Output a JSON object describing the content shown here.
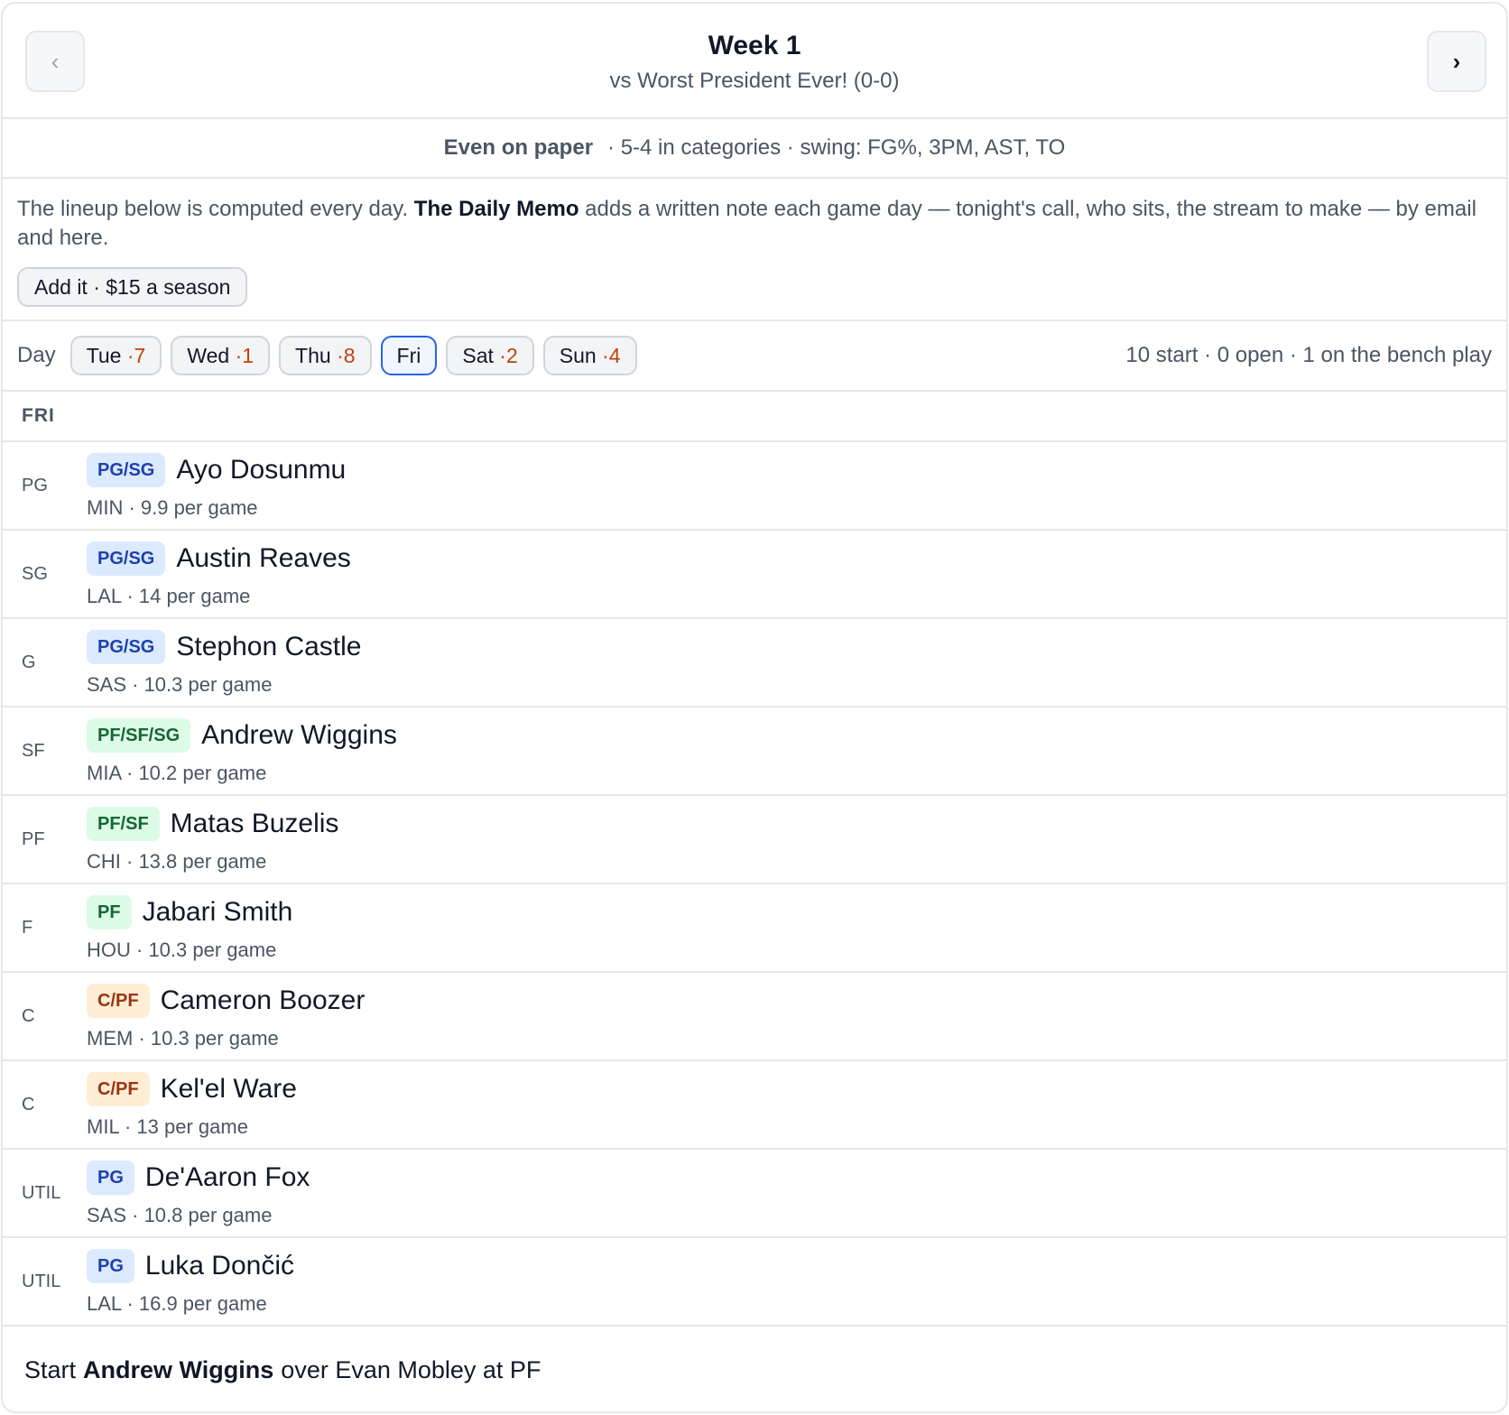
{
  "header": {
    "prev_icon": "‹",
    "next_icon": "›",
    "title": "Week 1",
    "subtitle": "vs Worst President Ever! (0-0)"
  },
  "summary": {
    "verdict": "Even on paper",
    "details": "· 5-4 in categories · swing: FG%, 3PM, AST, TO"
  },
  "memo": {
    "text_before": "The lineup below is computed every day. ",
    "product": "The Daily Memo",
    "text_after": " adds a written note each game day — tonight's call, who sits, the stream to make — by email and here.",
    "button_label": "Add it · $15 a season"
  },
  "days": {
    "label": "Day",
    "items": [
      {
        "name": "Tue",
        "count": " ·7"
      },
      {
        "name": "Wed",
        "count": " ·1"
      },
      {
        "name": "Thu",
        "count": " ·8"
      },
      {
        "name": "Fri",
        "count": ""
      },
      {
        "name": "Sat",
        "count": " ·2"
      },
      {
        "name": "Sun",
        "count": " ·4"
      }
    ],
    "selected": "Fri",
    "status": "10 start · 0 open · 1 on the bench play"
  },
  "section_label": "FRI",
  "lineup": [
    {
      "slot": "PG",
      "positions": "PG/SG",
      "name": "Ayo Dosunmu",
      "meta": "MIN · 9.9 per game"
    },
    {
      "slot": "SG",
      "positions": "PG/SG",
      "name": "Austin Reaves",
      "meta": "LAL · 14 per game"
    },
    {
      "slot": "G",
      "positions": "PG/SG",
      "name": "Stephon Castle",
      "meta": "SAS · 10.3 per game"
    },
    {
      "slot": "SF",
      "positions": "PF/SF/SG",
      "name": "Andrew Wiggins",
      "meta": "MIA · 10.2 per game"
    },
    {
      "slot": "PF",
      "positions": "PF/SF",
      "name": "Matas Buzelis",
      "meta": "CHI · 13.8 per game"
    },
    {
      "slot": "F",
      "positions": "PF",
      "name": "Jabari Smith",
      "meta": "HOU · 10.3 per game"
    },
    {
      "slot": "C",
      "positions": "C/PF",
      "name": "Cameron Boozer",
      "meta": "MEM · 10.3 per game"
    },
    {
      "slot": "C",
      "positions": "C/PF",
      "name": "Kel'el Ware",
      "meta": "MIL · 13 per game"
    },
    {
      "slot": "UTIL",
      "positions": "PG",
      "name": "De'Aaron Fox",
      "meta": "SAS · 10.8 per game"
    },
    {
      "slot": "UTIL",
      "positions": "PG",
      "name": "Luka Dončić",
      "meta": "LAL · 16.9 per game"
    }
  ],
  "footer": {
    "prefix": "Start",
    "player": "Andrew Wiggins",
    "suffix": "over Evan Mobley at PF"
  },
  "colors": {
    "guard_badge": "#dbeafe",
    "forward_badge": "#dcfce7",
    "center_badge": "#ffedd5",
    "day_count": "#c2410c",
    "active_day_border": "#2563eb"
  }
}
